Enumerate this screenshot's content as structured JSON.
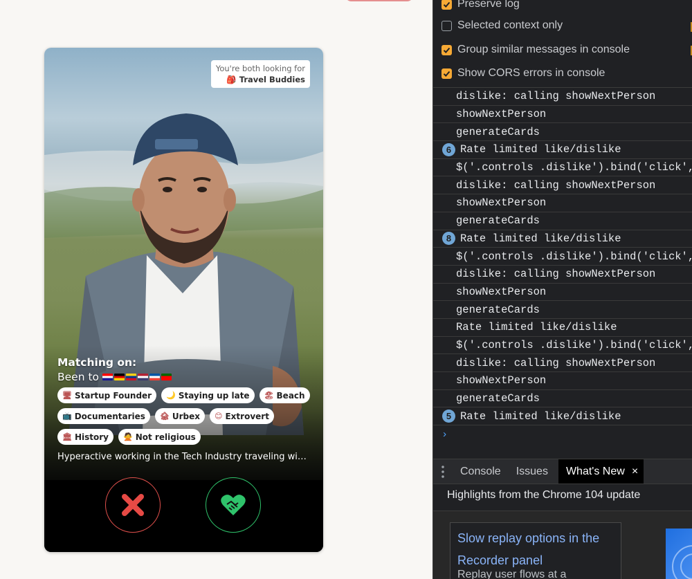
{
  "card": {
    "looking_for_label": "You're both looking for",
    "looking_for_value": "Travel Buddies",
    "match_title": "Matching on:",
    "been_to_label": "Been to",
    "flags": [
      {
        "name": "croatia-flag",
        "colors": [
          "#ff0000",
          "#ffffff",
          "#171796"
        ]
      },
      {
        "name": "germany-flag",
        "colors": [
          "#000000",
          "#dd0000",
          "#ffce00"
        ]
      },
      {
        "name": "colombia-flag",
        "colors": [
          "#fcd116",
          "#003893",
          "#ce1126"
        ]
      },
      {
        "name": "usa-flag",
        "colors": [
          "#b22234",
          "#ffffff",
          "#3c3b6e"
        ]
      },
      {
        "name": "france-flag",
        "colors": [
          "#0055a4",
          "#ffffff",
          "#ef4135"
        ]
      },
      {
        "name": "portugal-flag",
        "colors": [
          "#006600",
          "#ff0000",
          "#ff0000"
        ]
      }
    ],
    "tags": [
      [
        {
          "icon": "🖥",
          "label": "Startup Founder"
        },
        {
          "icon": "🌙",
          "label": "Staying up late"
        },
        {
          "icon": "🏖",
          "label": "Beach"
        }
      ],
      [
        {
          "icon": "📺",
          "label": "Documentaries"
        },
        {
          "icon": "🏚",
          "label": "Urbex"
        },
        {
          "icon": "😊",
          "label": "Extrovert"
        }
      ],
      [
        {
          "icon": "🏛",
          "label": "History"
        },
        {
          "icon": "🙅",
          "label": "Not religious"
        }
      ]
    ],
    "bio": "Hyperactive working in the Tech Industry traveling with ...",
    "dislike_color": "#e0504c",
    "like_color": "#2fc36b"
  },
  "devtools": {
    "options": [
      {
        "label": "Preserve log",
        "checked": true
      },
      {
        "label": "Selected context only",
        "checked": false
      },
      {
        "label": "Group similar messages in console",
        "checked": true
      },
      {
        "label": "Show CORS errors in console",
        "checked": true
      }
    ],
    "log": [
      {
        "text": "dislike: calling showNextPerson",
        "count": null
      },
      {
        "text": "showNextPerson",
        "count": null
      },
      {
        "text": "generateCards",
        "count": null
      },
      {
        "text": "Rate limited like/dislike",
        "count": "6"
      },
      {
        "text": "$('.controls .dislike').bind('click',fu",
        "count": null
      },
      {
        "text": "dislike: calling showNextPerson",
        "count": null
      },
      {
        "text": "showNextPerson",
        "count": null
      },
      {
        "text": "generateCards",
        "count": null
      },
      {
        "text": "Rate limited like/dislike",
        "count": "8"
      },
      {
        "text": "$('.controls .dislike').bind('click',fu",
        "count": null
      },
      {
        "text": "dislike: calling showNextPerson",
        "count": null
      },
      {
        "text": "showNextPerson",
        "count": null
      },
      {
        "text": "generateCards",
        "count": null
      },
      {
        "text": "Rate limited like/dislike",
        "count": null
      },
      {
        "text": "$('.controls .dislike').bind('click',fu",
        "count": null
      },
      {
        "text": "dislike: calling showNextPerson",
        "count": null
      },
      {
        "text": "showNextPerson",
        "count": null
      },
      {
        "text": "generateCards",
        "count": null
      },
      {
        "text": "Rate limited like/dislike",
        "count": "5"
      }
    ],
    "prompt": "›",
    "drawer": {
      "tabs": [
        "Console",
        "Issues"
      ],
      "active_tab": "What's New",
      "close": "×"
    },
    "whats_new": {
      "title": "Highlights from the Chrome 104 update",
      "link_line1": "Slow replay options in the",
      "link_line2": "Recorder panel",
      "desc": "Replay user flows at a"
    },
    "accent_color": "#f6a935",
    "badge_color": "#70a6d6"
  }
}
